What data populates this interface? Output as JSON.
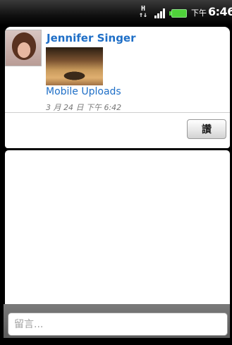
{
  "status_bar": {
    "network_icon": "data-transfer-icon",
    "network_glyph": "H",
    "signal_icon": "signal-strength-icon",
    "battery_icon": "battery-icon",
    "ampm": "下午",
    "time": "6:46"
  },
  "post": {
    "author": "Jennifer Singer",
    "album": "Mobile Uploads",
    "timestamp": "3 月 24 日 下午 6:42",
    "like_label": "讚"
  },
  "comment_box": {
    "placeholder": "留言..."
  },
  "colors": {
    "link": "#1f6fc7",
    "battery": "#4fd23a"
  }
}
